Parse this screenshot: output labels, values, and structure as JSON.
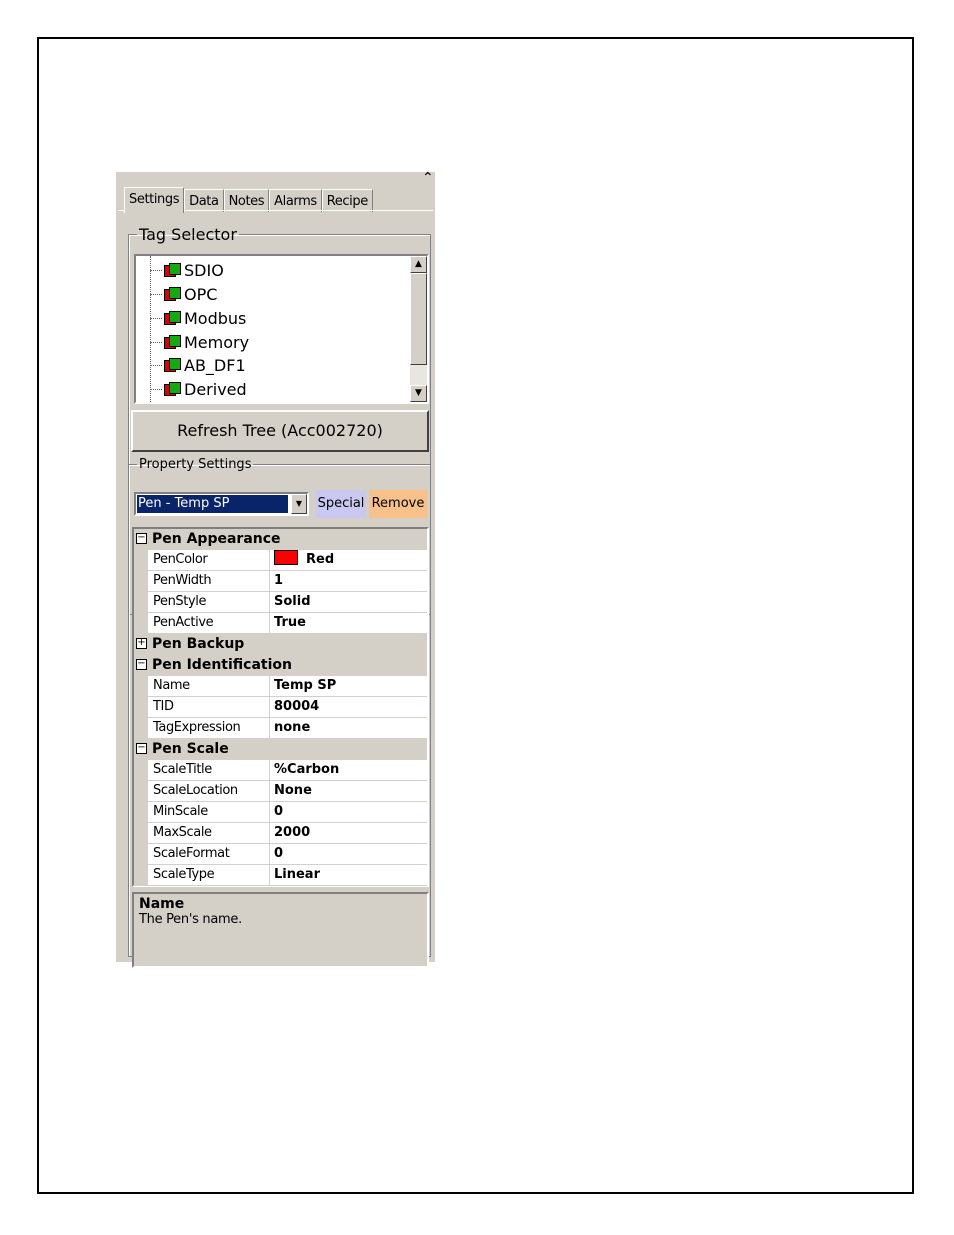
{
  "tabs": [
    "Settings",
    "Data",
    "Notes",
    "Alarms",
    "Recipe"
  ],
  "tag_selector": {
    "legend": "Tag Selector",
    "items": [
      "SDIO",
      "OPC",
      "Modbus",
      "Memory",
      "AB_DF1",
      "Derived"
    ]
  },
  "refresh_button": "Refresh Tree (Acc002720)",
  "property_settings": {
    "legend": "Property Settings",
    "selected_pen": "Pen - Temp SP",
    "special_label": "Special",
    "remove_label": "Remove",
    "special_color": "#c8c8f0",
    "remove_color": "#f8c08a"
  },
  "grid": {
    "pen_appearance": {
      "label": "Pen Appearance",
      "rows": [
        {
          "name": "PenColor",
          "value": "Red"
        },
        {
          "name": "PenWidth",
          "value": "1"
        },
        {
          "name": "PenStyle",
          "value": "Solid"
        },
        {
          "name": "PenActive",
          "value": "True"
        }
      ]
    },
    "pen_backup": {
      "label": "Pen Backup"
    },
    "pen_identification": {
      "label": "Pen Identification",
      "rows": [
        {
          "name": "Name",
          "value": "Temp SP"
        },
        {
          "name": "TID",
          "value": "80004"
        },
        {
          "name": "TagExpression",
          "value": "none"
        }
      ]
    },
    "pen_scale": {
      "label": "Pen Scale",
      "rows": [
        {
          "name": "ScaleTitle",
          "value": "%Carbon"
        },
        {
          "name": "ScaleLocation",
          "value": "None"
        },
        {
          "name": "MinScale",
          "value": "0"
        },
        {
          "name": "MaxScale",
          "value": "2000"
        },
        {
          "name": "ScaleFormat",
          "value": "0"
        },
        {
          "name": "ScaleType",
          "value": "Linear"
        }
      ]
    }
  },
  "help": {
    "title": "Name",
    "description": "The Pen's name."
  },
  "colors": {
    "pen_color_swatch": "#ff0000",
    "selection": "#0a246a",
    "panel": "#d4d0c8"
  }
}
